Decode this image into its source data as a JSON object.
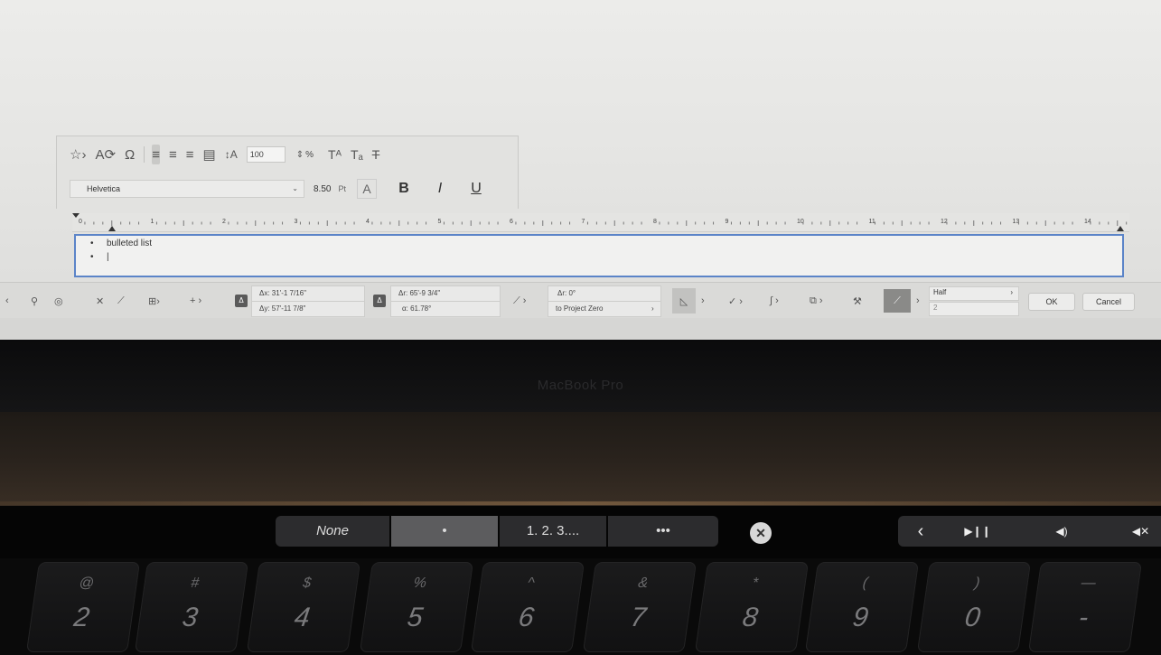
{
  "format_toolbar": {
    "line_spacing_value": "100",
    "percent_label": "%",
    "font_name": "Helvetica",
    "font_size": "8.50",
    "font_unit": "Pt",
    "color_label": "A",
    "bold_label": "B",
    "italic_label": "I",
    "underline_label": "U",
    "superscript_label": "Tᴬ",
    "subscript_label": "Tₐ",
    "strikethrough_label": "T"
  },
  "ruler": {
    "labels": [
      "0",
      "1",
      "2",
      "3",
      "4",
      "5",
      "6",
      "7",
      "8",
      "9",
      "10",
      "11",
      "12",
      "13",
      "14"
    ]
  },
  "text_block": {
    "line1_bullet": "•",
    "line1_text": "bulleted list",
    "line2_bullet": "•",
    "line2_text": "|"
  },
  "infobox": {
    "dx": "Δx: 31'-1 7/16\"",
    "dy": "Δy: 57'-11 7/8\"",
    "dr": "Δr: 65'-9 3/4\"",
    "angle": "α: 61.78°",
    "beta": "Δr: 0°",
    "project_zero": "to Project Zero",
    "half_label": "Half",
    "half_sub": "2",
    "ok_label": "OK",
    "cancel_label": "Cancel"
  },
  "laptop": {
    "brand": "MacBook Pro"
  },
  "touchbar": {
    "segments": [
      "None",
      "•",
      "1. 2. 3....",
      "•••"
    ],
    "active_index": 1,
    "close_glyph": "✕",
    "back_glyph": "‹",
    "play_pause_glyph": "▶❙❙",
    "volume_glyph": "◀)",
    "mute_glyph": "◀✕"
  },
  "keyboard": {
    "keys": [
      {
        "upper": "@",
        "lower": "2"
      },
      {
        "upper": "#",
        "lower": "3"
      },
      {
        "upper": "$",
        "lower": "4"
      },
      {
        "upper": "%",
        "lower": "5"
      },
      {
        "upper": "^",
        "lower": "6"
      },
      {
        "upper": "&",
        "lower": "7"
      },
      {
        "upper": "*",
        "lower": "8"
      },
      {
        "upper": "(",
        "lower": "9"
      },
      {
        "upper": ")",
        "lower": "0"
      },
      {
        "upper": "—",
        "lower": "-"
      }
    ]
  },
  "colors": {
    "text_frame_border": "#5b84c8",
    "touchbar_segment": "#2c2c2e",
    "touchbar_active": "#5c5c5e"
  }
}
